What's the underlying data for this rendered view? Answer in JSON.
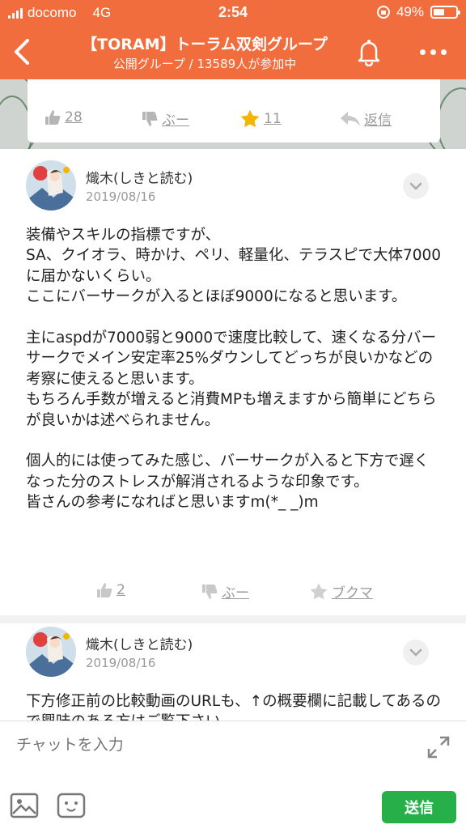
{
  "status_bar": {
    "carrier": "docomo",
    "network": "4G",
    "time": "2:54",
    "battery": "49%",
    "battery_level": 0.49
  },
  "header": {
    "title": "【TORAM】トーラム双剣グループ",
    "subtitle": "公開グループ / 13589人が参加中"
  },
  "previous_post_actions": {
    "like_count": "28",
    "dislike_label": "ぶー",
    "star_count": "11",
    "reply_label": "返信"
  },
  "posts": [
    {
      "author": "熾木(しきと読む)",
      "date": "2019/08/16",
      "body": "装備やスキルの指標ですが、\nSA、クイオラ、時かけ、ペリ、軽量化、テラスピで大体7000に届かないくらい。\nここにバーサークが入るとほぼ9000になると思います。\n\n主にaspdが7000弱と9000で速度比較して、速くなる分バーサークでメイン安定率25%ダウンしてどっちが良いかなどの考察に使えると思います。\nもちろん手数が増えると消費MPも増えますから簡単にどちらが良いかは述べられません。\n\n個人的には使ってみた感じ、バーサークが入ると下方で遅くなった分のストレスが解消されるような印象です。\n皆さんの参考になればと思いますm(*_ _)m",
      "like_count": "2",
      "dislike_label": "ぶー",
      "bookmark_label": "ブクマ"
    },
    {
      "author": "熾木(しきと読む)",
      "date": "2019/08/16",
      "body": "下方修正前の比較動画のURLも、↑の概要欄に記載してあるので興味のある方はご覧下さい。"
    }
  ],
  "chat": {
    "placeholder": "チャットを入力",
    "send_label": "送信"
  },
  "colors": {
    "header": "#f26d3d",
    "send_button": "#27b04a",
    "star": "#f5b400"
  }
}
